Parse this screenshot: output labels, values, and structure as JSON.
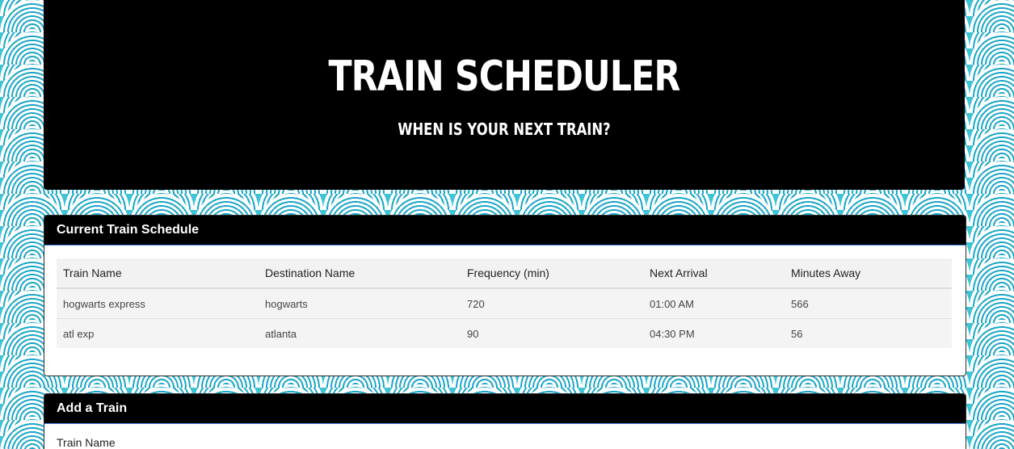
{
  "header": {
    "title": "TRAIN SCHEDULER",
    "subtitle": "WHEN IS YOUR NEXT TRAIN?"
  },
  "schedule": {
    "heading": "Current Train Schedule",
    "columns": [
      "Train Name",
      "Destination Name",
      "Frequency (min)",
      "Next Arrival",
      "Minutes Away"
    ],
    "rows": [
      [
        "hogwarts express",
        "hogwarts",
        "720",
        "01:00 AM",
        "566"
      ],
      [
        "atl exp",
        "atlanta",
        "90",
        "04:30 PM",
        "56"
      ]
    ]
  },
  "add_train": {
    "heading": "Add a Train",
    "field_label_train_name": "Train Name"
  }
}
